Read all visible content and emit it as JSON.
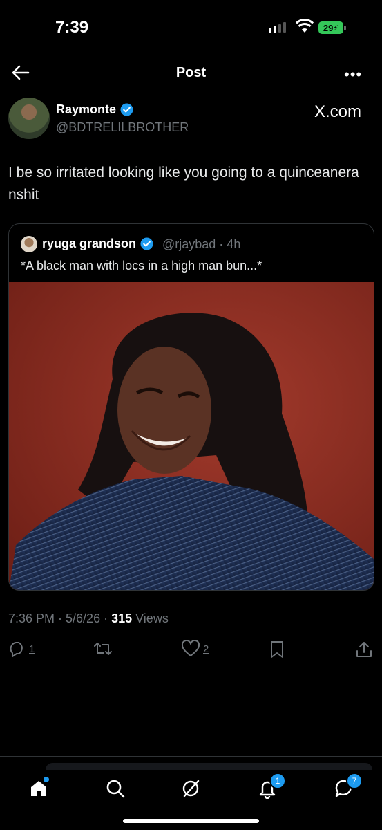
{
  "status": {
    "time": "7:39",
    "battery": "29"
  },
  "header": {
    "title": "Post",
    "back_icon": "arrow-left-icon",
    "more_icon": "more-dots-icon",
    "more_label": "•••"
  },
  "author": {
    "name": "Raymonte",
    "handle": "@BDTRELILBROTHER",
    "source": "X.com"
  },
  "tweet": {
    "text": "I be so irritated looking like you going to a quinceanera nshit"
  },
  "quote": {
    "name": "ryuga grandson",
    "handle": "@rjaybad · 4h",
    "text": "*A black man with locs in a high man bun...*"
  },
  "meta": {
    "timestamp": "7:36 PM · 5/6/26 · ",
    "views_count": "315",
    "views_label": " Views"
  },
  "actions": {
    "replies": "1",
    "likes": "2"
  },
  "tabs": {
    "notifications_badge": "1",
    "messages_badge": "7"
  },
  "colors": {
    "accent": "#1d9bf0",
    "background": "#000000",
    "muted": "#71767b"
  }
}
